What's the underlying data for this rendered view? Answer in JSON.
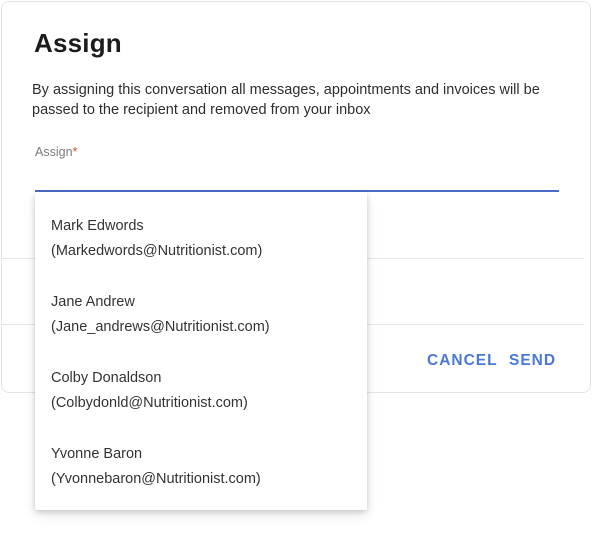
{
  "dialog": {
    "title": "Assign",
    "description": "By assigning this conversation all messages, appointments and invoices will be passed to the recipient and removed from your inbox",
    "field": {
      "label": "Assign",
      "required_marker": "*",
      "value": ""
    },
    "actions": {
      "cancel_label": "CANCEL",
      "send_label": "SEND"
    }
  },
  "dropdown": {
    "options": [
      {
        "name": "Mark Edwords",
        "email": "(Markedwords@Nutritionist.com)"
      },
      {
        "name": "Jane Andrew",
        "email": "(Jane_andrews@Nutritionist.com)"
      },
      {
        "name": "Colby Donaldson",
        "email": "(Colbydonld@Nutritionist.com)"
      },
      {
        "name": "Yvonne Baron",
        "email": "(Yvonnebaron@Nutritionist.com)"
      }
    ]
  },
  "colors": {
    "accent": "#4a78d8",
    "input_underline": "#4a6cc7",
    "required": "#d0533a"
  }
}
